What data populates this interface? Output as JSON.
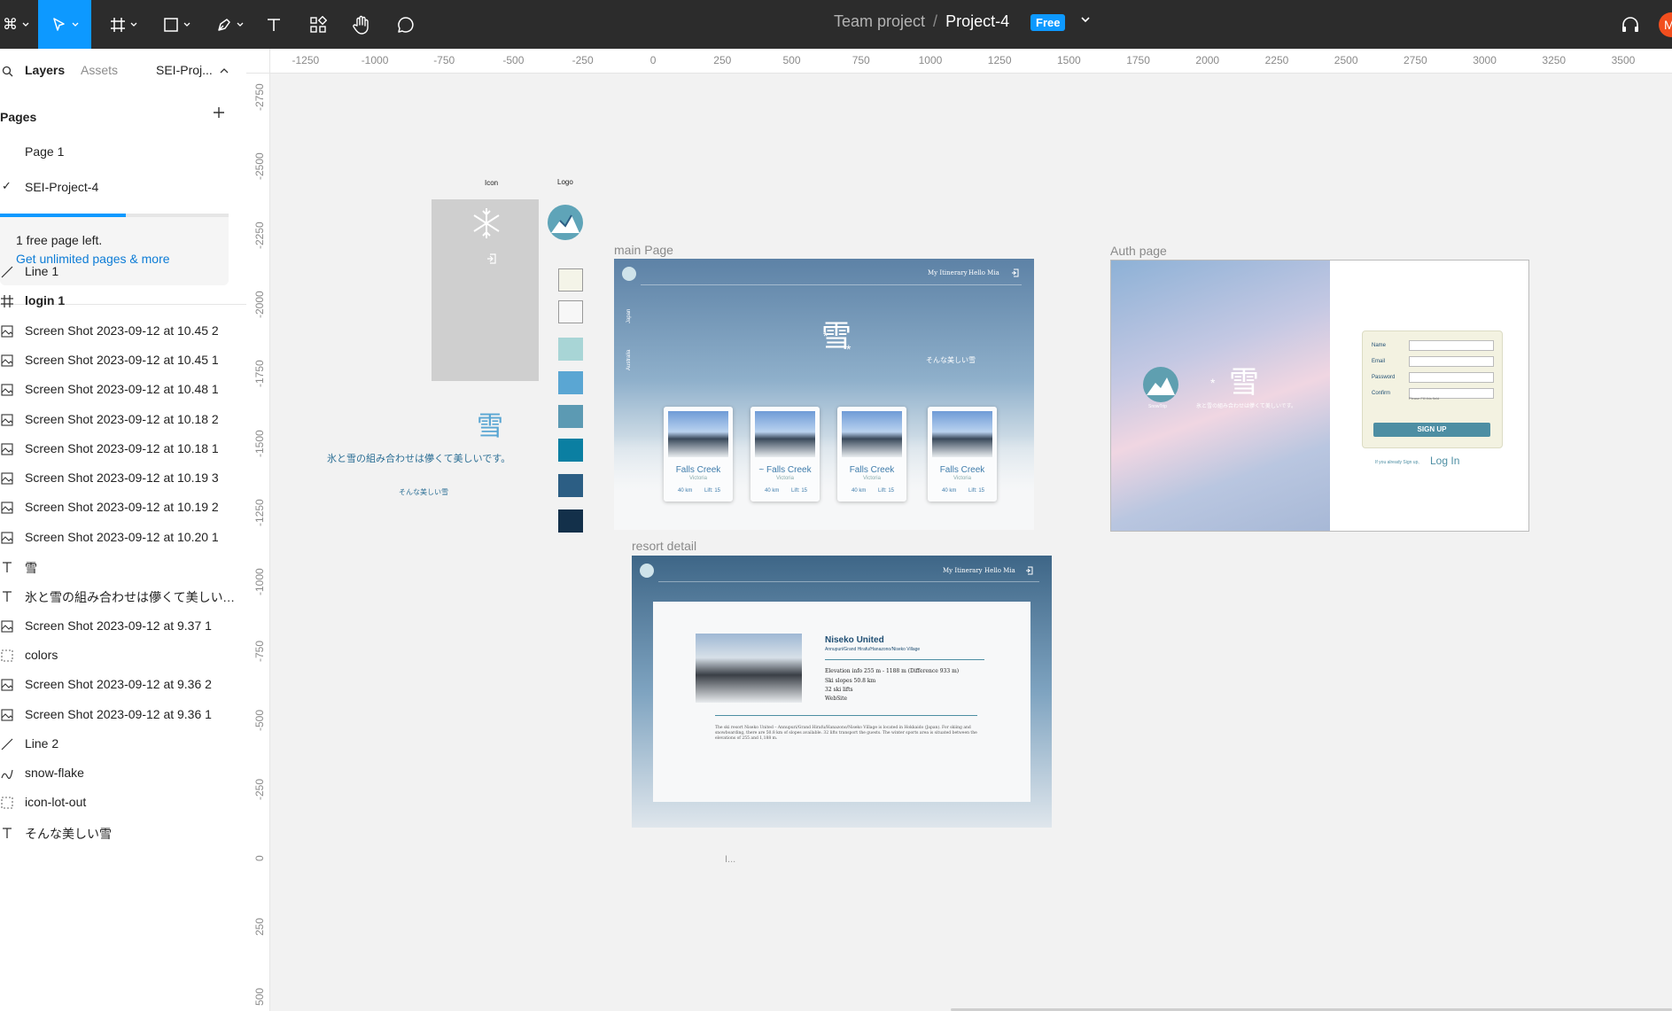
{
  "toolbar": {
    "team": "Team project",
    "separator": "/",
    "project": "Project-4",
    "badge": "Free",
    "avatar": "M"
  },
  "sidebar": {
    "tabs": [
      "Layers",
      "Assets",
      "SEI-Proj..."
    ],
    "pages_title": "Pages",
    "pages": [
      "Page 1",
      "SEI-Project-4"
    ],
    "selected_page_mark": "✓",
    "plan_used_fraction": 0.55,
    "free_notice": "1 free page left.",
    "upgrade_link": "Get unlimited pages & more",
    "layers": [
      {
        "icon": "line-icon",
        "label": "Line 1",
        "bold": false
      },
      {
        "icon": "frame-icon",
        "label": "login 1",
        "bold": true
      },
      {
        "icon": "image-icon",
        "label": "Screen Shot 2023-09-12 at 10.45 2",
        "bold": false
      },
      {
        "icon": "image-icon",
        "label": "Screen Shot 2023-09-12 at 10.45 1",
        "bold": false
      },
      {
        "icon": "image-icon",
        "label": "Screen Shot 2023-09-12 at 10.48 1",
        "bold": false
      },
      {
        "icon": "image-icon",
        "label": "Screen Shot 2023-09-12 at 10.18 2",
        "bold": false
      },
      {
        "icon": "image-icon",
        "label": "Screen Shot 2023-09-12 at 10.18 1",
        "bold": false
      },
      {
        "icon": "image-icon",
        "label": "Screen Shot 2023-09-12 at 10.19 3",
        "bold": false
      },
      {
        "icon": "image-icon",
        "label": "Screen Shot 2023-09-12 at 10.19 2",
        "bold": false
      },
      {
        "icon": "image-icon",
        "label": "Screen Shot 2023-09-12 at 10.20 1",
        "bold": false
      },
      {
        "icon": "text-icon",
        "label": "雪",
        "bold": false
      },
      {
        "icon": "text-icon",
        "label": "氷と雪の組み合わせは儚くて美しいです。",
        "bold": false
      },
      {
        "icon": "image-icon",
        "label": "Screen Shot 2023-09-12 at 9.37 1",
        "bold": false
      },
      {
        "icon": "group-icon",
        "label": "colors",
        "bold": false
      },
      {
        "icon": "image-icon",
        "label": "Screen Shot 2023-09-12 at 9.36 2",
        "bold": false
      },
      {
        "icon": "image-icon",
        "label": "Screen Shot 2023-09-12 at 9.36 1",
        "bold": false
      },
      {
        "icon": "line-icon",
        "label": "Line 2",
        "bold": false
      },
      {
        "icon": "vector-icon",
        "label": "snow-flake",
        "bold": false
      },
      {
        "icon": "group-icon",
        "label": "icon-lot-out",
        "bold": false
      },
      {
        "icon": "text-icon",
        "label": "そんな美しい雪",
        "bold": false
      }
    ]
  },
  "rulers": {
    "horizontal": [
      "-1250",
      "-1000",
      "-750",
      "-500",
      "-250",
      "0",
      "250",
      "500",
      "750",
      "1000",
      "1250",
      "1500",
      "1750",
      "2000",
      "2250",
      "2500",
      "2750",
      "3000",
      "3250",
      "3500"
    ],
    "vertical": [
      "-2750",
      "-2500",
      "-2250",
      "-2000",
      "-1750",
      "-1500",
      "-1250",
      "-1000",
      "-750",
      "-500",
      "-250",
      "0",
      "250",
      "500"
    ]
  },
  "canvas": {
    "icon_label": "Icon",
    "logo_label": "Logo",
    "kanji": "雪",
    "tagline": "氷と雪の組み合わせは儚くて美しいです。",
    "subtagline": "そんな美しい雪",
    "colors": [
      "#f4f4e8",
      "#f7f7f7",
      "#a8d5d6",
      "#5aa6d3",
      "#5c9ab3",
      "#0b7fa2",
      "#2c5e84",
      "#13304a"
    ],
    "main_page": {
      "label": "main Page",
      "nav_itinerary": "My Itinerary",
      "nav_hello": "Hello Mia",
      "side_japan": "Japan",
      "side_australia": "Australia",
      "kanji": "雪",
      "subtitle": "そんな美しい雪",
      "cards": [
        {
          "name": "Falls Creek",
          "region": "Victoria",
          "km": "40 km",
          "lifts": "Lift: 15"
        },
        {
          "name": "~ Falls Creek",
          "region": "Victoria",
          "km": "40 km",
          "lifts": "Lift: 15"
        },
        {
          "name": "Falls Creek",
          "region": "Victoria",
          "km": "40 km",
          "lifts": "Lift: 15"
        },
        {
          "name": "Falls Creek",
          "region": "Victoria",
          "km": "40 km",
          "lifts": "Lift: 15"
        }
      ]
    },
    "auth_page": {
      "label": "Auth page",
      "kanji": "雪",
      "logo_caption": "SnowTrip",
      "tagline": "氷と雪の組み合わせは儚くて美しいです。",
      "fields": [
        "Name",
        "Email",
        "Password",
        "Confirm"
      ],
      "hint": "Please Fill this field",
      "submit": "SIGN UP",
      "already": "If you already Sign up,",
      "login": "Log In"
    },
    "resort_detail": {
      "label": "resort detail",
      "nav_itinerary": "My Itinerary",
      "nav_hello": "Hello Mia",
      "name": "Niseko United",
      "area": "Annupuri/Grand Hirafu/Hanazono/Niseko Village",
      "elevation": "Elevation info    255 m - 1188 m (Difference 933 m)",
      "slopes": "Ski slopes    50.8 km",
      "lifts": "32 ski lifts",
      "website": "WebSite",
      "description": "The ski resort Niseko United – Annupuri/Grand Hirafu/Hanazono/Niseko Village is located in Hokkaido (Japan). For skiing and snowboarding, there are 50.8 km of slopes available. 32 lifts transport the guests. The winter sports area is situated between the elevations of 255 and 1,188 m."
    },
    "stray_text": "I..."
  }
}
